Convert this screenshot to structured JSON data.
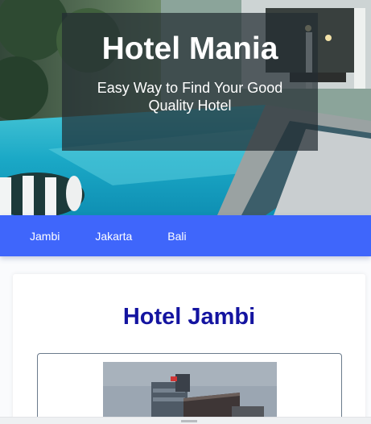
{
  "hero": {
    "title": "Hotel Mania",
    "subtitle": "Easy Way to Find Your Good Quality Hotel"
  },
  "nav": {
    "items": [
      {
        "label": "Jambi"
      },
      {
        "label": "Jakarta"
      },
      {
        "label": "Bali"
      }
    ]
  },
  "main": {
    "hotel_title": "Hotel Jambi"
  },
  "colors": {
    "nav_background": "#3f66fb",
    "hotel_title": "#1414a0"
  }
}
